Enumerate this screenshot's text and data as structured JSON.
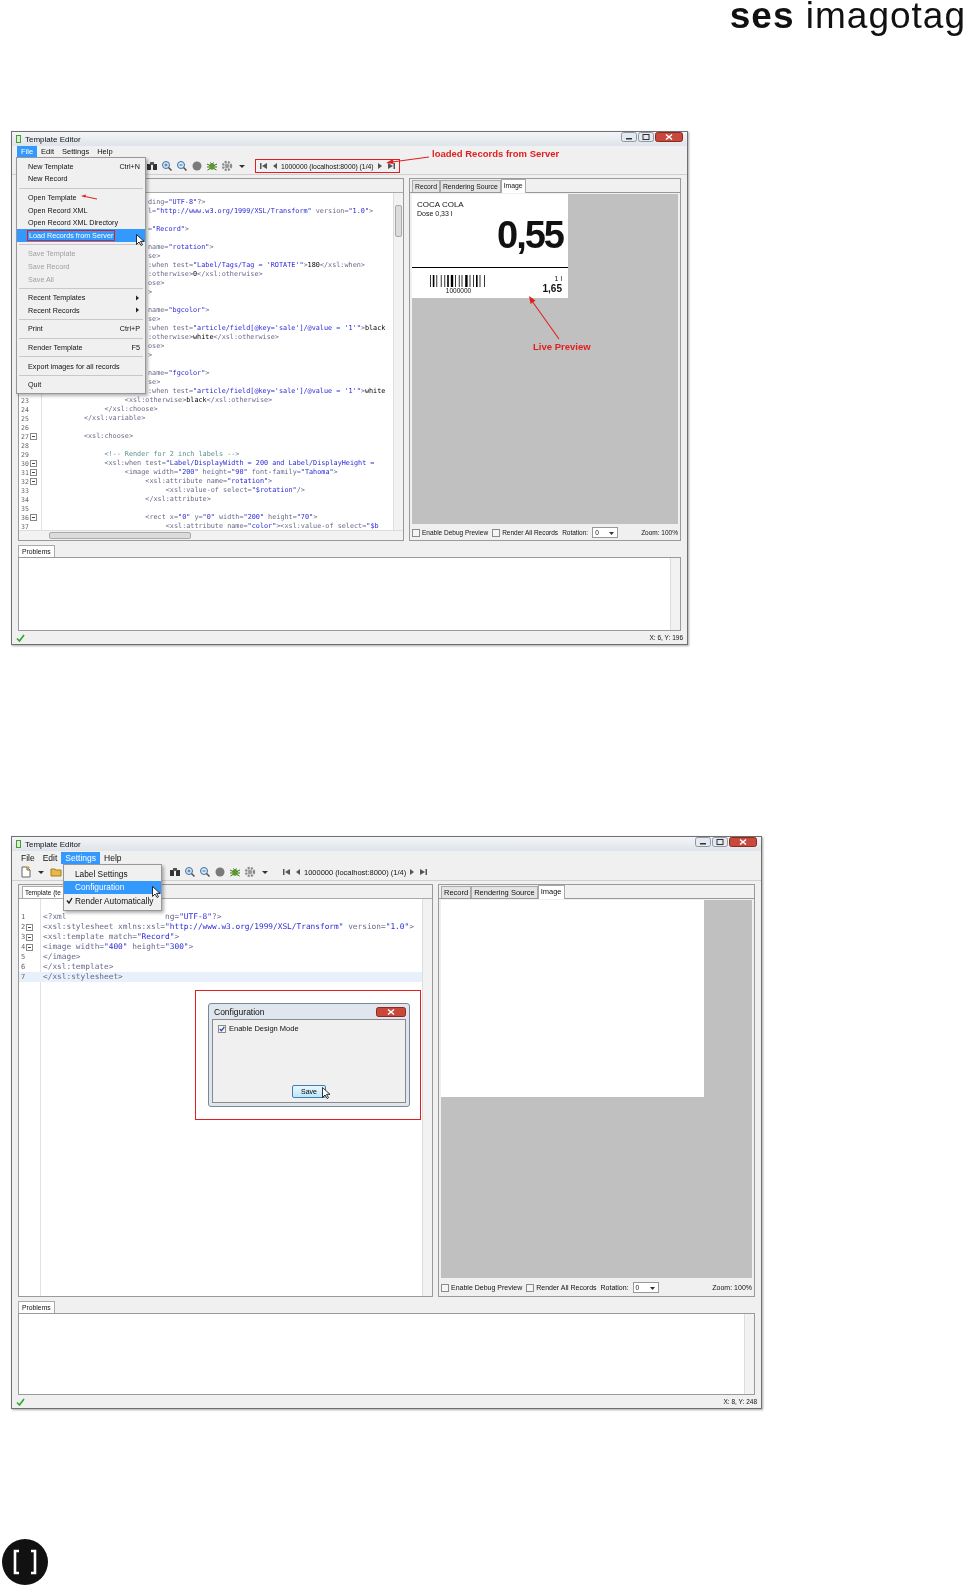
{
  "logo": "**ses** imagotag",
  "windows": [
    {
      "title": "Template Editor",
      "menu_bar": [
        {
          "label": "File",
          "selected": true
        },
        {
          "label": "Edit",
          "selected": false
        },
        {
          "label": "Settings",
          "selected": false
        },
        {
          "label": "Help",
          "selected": false
        }
      ],
      "open_menu": {
        "items": [
          {
            "kind": "item",
            "label": "New Template",
            "shortcut": "Ctrl+N",
            "disabled": false,
            "selected": false
          },
          {
            "kind": "item",
            "label": "New Record",
            "disabled": false,
            "selected": false
          },
          {
            "kind": "separator"
          },
          {
            "kind": "item",
            "label": "Open Template",
            "disabled": false,
            "selected": false,
            "annotated": true
          },
          {
            "kind": "item",
            "label": "Open Record XML",
            "disabled": false,
            "selected": false
          },
          {
            "kind": "item",
            "label": "Open Record XML Directory",
            "disabled": false,
            "selected": false
          },
          {
            "kind": "item",
            "label": "Load Records from Server",
            "disabled": false,
            "selected": true,
            "highlighted": true
          },
          {
            "kind": "separator"
          },
          {
            "kind": "item",
            "label": "Save Template",
            "disabled": true,
            "selected": false
          },
          {
            "kind": "item",
            "label": "Save Record",
            "disabled": true,
            "selected": false
          },
          {
            "kind": "item",
            "label": "Save All",
            "disabled": true,
            "selected": false
          },
          {
            "kind": "separator"
          },
          {
            "kind": "item",
            "label": "Recent Templates",
            "disabled": false,
            "selected": false,
            "submenu": true
          },
          {
            "kind": "item",
            "label": "Recent Records",
            "disabled": false,
            "selected": false,
            "submenu": true
          },
          {
            "kind": "separator"
          },
          {
            "kind": "item",
            "label": "Print",
            "shortcut": "Ctrl+P",
            "disabled": false,
            "selected": false
          },
          {
            "kind": "separator"
          },
          {
            "kind": "item",
            "label": "Render Template",
            "shortcut": "F5",
            "disabled": false,
            "selected": false
          },
          {
            "kind": "separator"
          },
          {
            "kind": "item",
            "label": "Export images for all records",
            "disabled": false,
            "selected": false
          },
          {
            "kind": "separator"
          },
          {
            "kind": "item",
            "label": "Quit",
            "disabled": false,
            "selected": false
          }
        ]
      },
      "toolbar": [
        {
          "kind": "find"
        },
        {
          "kind": "zoom-in"
        },
        {
          "kind": "zoom-out"
        },
        {
          "kind": "stop"
        },
        {
          "kind": "bug"
        },
        {
          "kind": "gear"
        },
        {
          "kind": "caret"
        }
      ],
      "record_nav": {
        "label": "1000000 (localhost:8000) (1/4)",
        "highlighted": true
      },
      "editor": {
        "horizontal_scrollbar": true,
        "lines": [
          {
            "kind": "code",
            "under_menu": true,
            "text": "ding=\"UTF-8\"?>"
          },
          {
            "kind": "code",
            "under_menu": true,
            "text": "l=\"http://www.w3.org/1999/XSL/Transform\" version=\"1.0\">"
          },
          {
            "kind": "code",
            "under_menu": true
          },
          {
            "kind": "code",
            "under_menu": true,
            "text": "=\"Record\">"
          },
          {
            "kind": "code",
            "under_menu": true
          },
          {
            "kind": "code",
            "under_menu": true,
            "text": "name=\"rotation\">"
          },
          {
            "kind": "code",
            "under_menu": true,
            "text": "se>"
          },
          {
            "kind": "code",
            "under_menu": true,
            "text": ":when test=\"Label/Tags/Tag = 'ROTATE'\">180</xsl:when>"
          },
          {
            "kind": "code",
            "under_menu": true,
            "text": ":otherwise>0</xsl:otherwise>"
          },
          {
            "kind": "code",
            "under_menu": true,
            "text": "ose>"
          },
          {
            "kind": "code",
            "under_menu": true,
            "text": ">"
          },
          {
            "kind": "code",
            "under_menu": true
          },
          {
            "kind": "code",
            "under_menu": true,
            "text": "name=\"bgcolor\">"
          },
          {
            "kind": "code",
            "under_menu": true,
            "text": "se>"
          },
          {
            "kind": "code",
            "under_menu": true,
            "text": ":when test=\"article/field[@key='sale']/@value = '1'\">black"
          },
          {
            "kind": "code",
            "under_menu": true,
            "text": ":otherwise>white</xsl:otherwise>"
          },
          {
            "kind": "code",
            "under_menu": true,
            "text": "ose>"
          },
          {
            "kind": "code",
            "under_menu": true,
            "text": ">"
          },
          {
            "kind": "code",
            "under_menu": true
          },
          {
            "kind": "code",
            "under_menu": true,
            "text": "name=\"fgcolor\">"
          },
          {
            "kind": "code",
            "under_menu": true,
            "text": "se>"
          },
          {
            "kind": "code",
            "under_menu": true,
            "text": ":when test=\"article/field[@key='sale']/@value = '1'\">white"
          },
          {
            "kind": "code",
            "number": "23",
            "text": "                    <xsl:otherwise>black</xsl:otherwise>"
          },
          {
            "kind": "code",
            "number": "24",
            "text": "               </xsl:choose>"
          },
          {
            "kind": "code",
            "number": "25",
            "text": "          </xsl:variable>"
          },
          {
            "kind": "code",
            "number": "26"
          },
          {
            "kind": "code",
            "number": "27",
            "foldable": true,
            "text": "          <xsl:choose>"
          },
          {
            "kind": "code",
            "number": "28"
          },
          {
            "kind": "comment",
            "number": "29",
            "text": "               <!-- Render for 2 inch labels -->"
          },
          {
            "kind": "code",
            "number": "30",
            "foldable": true,
            "text": "               <xsl:when test=\"Label/DisplayWidth = 200 and Label/DisplayHeight ="
          },
          {
            "kind": "code",
            "number": "31",
            "foldable": true,
            "text": "                    <image width=\"200\" height=\"90\" font-family=\"Tahoma\">"
          },
          {
            "kind": "code",
            "number": "32",
            "foldable": true,
            "text": "                         <xsl:attribute name=\"rotation\">"
          },
          {
            "kind": "code",
            "number": "33",
            "text": "                              <xsl:value-of select=\"$rotation\"/>"
          },
          {
            "kind": "code",
            "number": "34",
            "text": "                         </xsl:attribute>"
          },
          {
            "kind": "code",
            "number": "35"
          },
          {
            "kind": "code",
            "number": "36",
            "foldable": true,
            "text": "                         <rect x=\"0\" y=\"0\" width=\"200\" height=\"70\">"
          },
          {
            "kind": "code",
            "number": "37",
            "text": "                              <xsl:attribute name=\"color\"><xsl:value-of select=\"$b"
          }
        ]
      },
      "preview": {
        "tabs": [
          {
            "label": "Record",
            "selected": false
          },
          {
            "label": "Rendering Source",
            "selected": false
          },
          {
            "label": "Image",
            "selected": true
          }
        ],
        "label": {
          "kind": "price-label",
          "product": "COCA COLA",
          "size": "Dose 0,33 l",
          "price": "0,55",
          "barcode_number": "1000000",
          "unit": "1 l",
          "unit_price": "1,65"
        },
        "options": [
          {
            "label": "Enable Debug Preview",
            "checked": false
          },
          {
            "label": "Render All Records",
            "checked": false
          }
        ],
        "rotation_label": "Rotation:",
        "rotation_value": "0",
        "zoom": "Zoom: 100%"
      },
      "callouts": [
        {
          "kind": "toolbar",
          "text": "loaded Records from Server"
        },
        {
          "kind": "preview",
          "text": "Live Preview"
        }
      ],
      "problems_tab": "Problems",
      "status": "X: 6, Y: 196"
    },
    {
      "title": "Template Editor",
      "menu_bar": [
        {
          "label": "File",
          "selected": false
        },
        {
          "label": "Edit",
          "selected": false
        },
        {
          "label": "Settings",
          "selected": true
        },
        {
          "label": "Help",
          "selected": false
        }
      ],
      "open_menu": {
        "items": [
          {
            "kind": "item",
            "label": "Label Settings",
            "disabled": false,
            "selected": false,
            "checked": false
          },
          {
            "kind": "item",
            "label": "Configuration",
            "disabled": false,
            "selected": true,
            "checked": false
          },
          {
            "kind": "item",
            "label": "Render Automatically",
            "disabled": false,
            "selected": false,
            "checked": true
          }
        ]
      },
      "toolbar": [
        {
          "kind": "new-file"
        },
        {
          "kind": "caret"
        },
        {
          "kind": "folder"
        },
        {
          "kind": "find"
        },
        {
          "kind": "zoom-in"
        },
        {
          "kind": "zoom-out"
        },
        {
          "kind": "stop"
        },
        {
          "kind": "bug"
        },
        {
          "kind": "gear"
        },
        {
          "kind": "caret"
        }
      ],
      "record_nav": {
        "label": "1000000 (localhost:8000) (1/4)",
        "highlighted": false
      },
      "editor": {
        "tab": "Template (te",
        "horizontal_scrollbar": false,
        "lines": [
          {
            "kind": "code",
            "number": "1",
            "selected": false,
            "text": "<?xml                     ng=\"UTF-8\"?>"
          },
          {
            "kind": "code",
            "number": "2",
            "foldable": true,
            "selected": false,
            "text": "<xsl:stylesheet xmlns:xsl=\"http://www.w3.org/1999/XSL/Transform\" version=\"1.0\">"
          },
          {
            "kind": "code",
            "number": "3",
            "foldable": true,
            "selected": false,
            "text": "<xsl:template match=\"Record\">"
          },
          {
            "kind": "code",
            "number": "4",
            "foldable": true,
            "selected": false,
            "text": "<image width=\"400\" height=\"300\">"
          },
          {
            "kind": "code",
            "number": "5",
            "selected": false,
            "text": "</image>"
          },
          {
            "kind": "code",
            "number": "6",
            "selected": false,
            "text": "</xsl:template>"
          },
          {
            "kind": "code",
            "number": "7",
            "selected": true,
            "text": "</xsl:stylesheet>"
          }
        ]
      },
      "preview": {
        "tabs": [
          {
            "label": "Record",
            "selected": false
          },
          {
            "label": "Rendering Source",
            "selected": false
          },
          {
            "label": "Image",
            "selected": true
          }
        ],
        "label": {
          "kind": "blank"
        },
        "options": [
          {
            "label": "Enable Debug Preview",
            "checked": false
          },
          {
            "label": "Render All Records",
            "checked": false
          }
        ],
        "rotation_label": "Rotation:",
        "rotation_value": "0",
        "zoom": "Zoom: 100%"
      },
      "dialog": {
        "title": "Configuration",
        "highlighted": true,
        "checkbox": {
          "label": "Enable Design Mode",
          "checked": true
        },
        "button": "Save",
        "hovered": true
      },
      "problems_tab": "Problems",
      "status": "X: 8, Y: 248"
    }
  ]
}
